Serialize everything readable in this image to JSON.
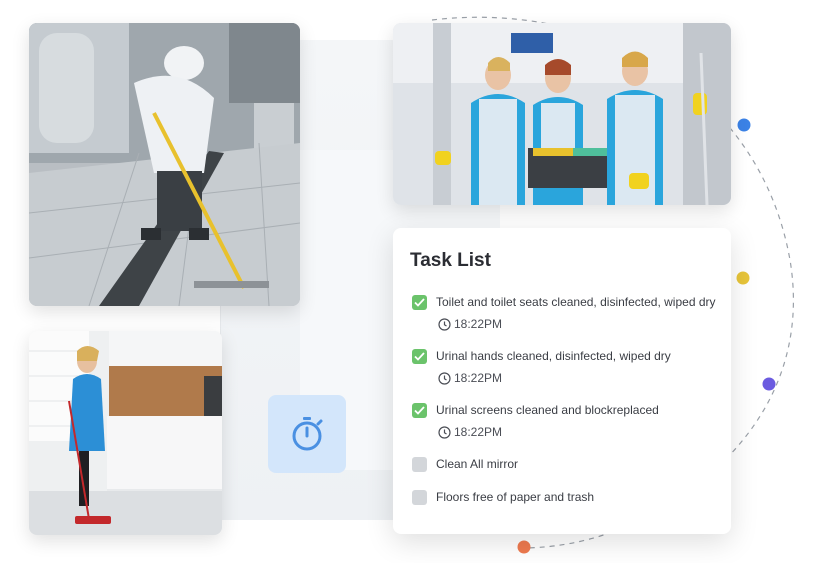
{
  "task_list": {
    "title": "Task List",
    "items": [
      {
        "label": "Toilet and toilet seats cleaned, disinfected, wiped dry",
        "time": "18:22PM",
        "checked": true
      },
      {
        "label": "Urinal hands cleaned, disinfected, wiped dry",
        "time": "18:22PM",
        "checked": true
      },
      {
        "label": "Urinal screens cleaned and blockreplaced",
        "time": "18:22PM",
        "checked": true
      },
      {
        "label": "Clean All mirror",
        "checked": false
      },
      {
        "label": "Floors free of paper and trash",
        "checked": false
      }
    ]
  },
  "timer_tile": {
    "icon": "stopwatch-icon",
    "color": "#4a90e2",
    "background": "#d3e6fb"
  },
  "photos": [
    {
      "subject": "worker-mopping-factory-floor-photo"
    },
    {
      "subject": "cleaning-team-photo"
    },
    {
      "subject": "woman-sweeping-kitchen-photo"
    }
  ],
  "orbit_dots": [
    {
      "color": "#3b82e6"
    },
    {
      "color": "#e8c53a"
    },
    {
      "color": "#6b5be0"
    },
    {
      "color": "#ef7a4f"
    }
  ],
  "colors": {
    "check": "#6bc36b",
    "unchecked": "#d3d6da",
    "title": "#2b2d33"
  }
}
